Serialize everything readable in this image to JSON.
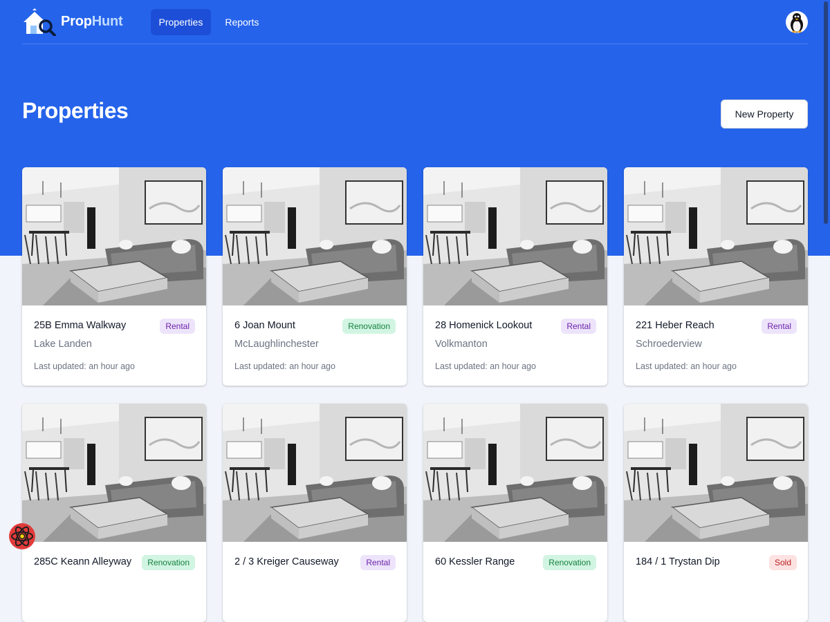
{
  "app": {
    "brand_prop": "Prop",
    "brand_hunt": "Hunt"
  },
  "nav": {
    "items": [
      {
        "label": "Properties",
        "active": true
      },
      {
        "label": "Reports",
        "active": false
      }
    ]
  },
  "page": {
    "title": "Properties",
    "new_button": "New Property"
  },
  "colors": {
    "accent": "#2563eb",
    "nav_active": "#1d4ed8"
  },
  "cards": [
    {
      "address": "25B Emma Walkway",
      "city": "Lake Landen",
      "badge": "Rental",
      "badge_type": "rental",
      "updated": "Last updated: an hour ago"
    },
    {
      "address": "6 Joan Mount",
      "city": "McLaughlinchester",
      "badge": "Renovation",
      "badge_type": "renovation",
      "updated": "Last updated: an hour ago"
    },
    {
      "address": "28 Homenick Lookout",
      "city": "Volkmanton",
      "badge": "Rental",
      "badge_type": "rental",
      "updated": "Last updated: an hour ago"
    },
    {
      "address": "221 Heber Reach",
      "city": "Schroederview",
      "badge": "Rental",
      "badge_type": "rental",
      "updated": "Last updated: an hour ago"
    },
    {
      "address": "285C Keann Alleyway",
      "city": "",
      "badge": "Renovation",
      "badge_type": "renovation",
      "updated": ""
    },
    {
      "address": "2 / 3 Kreiger Causeway",
      "city": "",
      "badge": "Rental",
      "badge_type": "rental",
      "updated": ""
    },
    {
      "address": "60 Kessler Range",
      "city": "",
      "badge": "Renovation",
      "badge_type": "renovation",
      "updated": ""
    },
    {
      "address": "184 / 1 Trystan Dip",
      "city": "",
      "badge": "Sold",
      "badge_type": "sold",
      "updated": ""
    }
  ]
}
